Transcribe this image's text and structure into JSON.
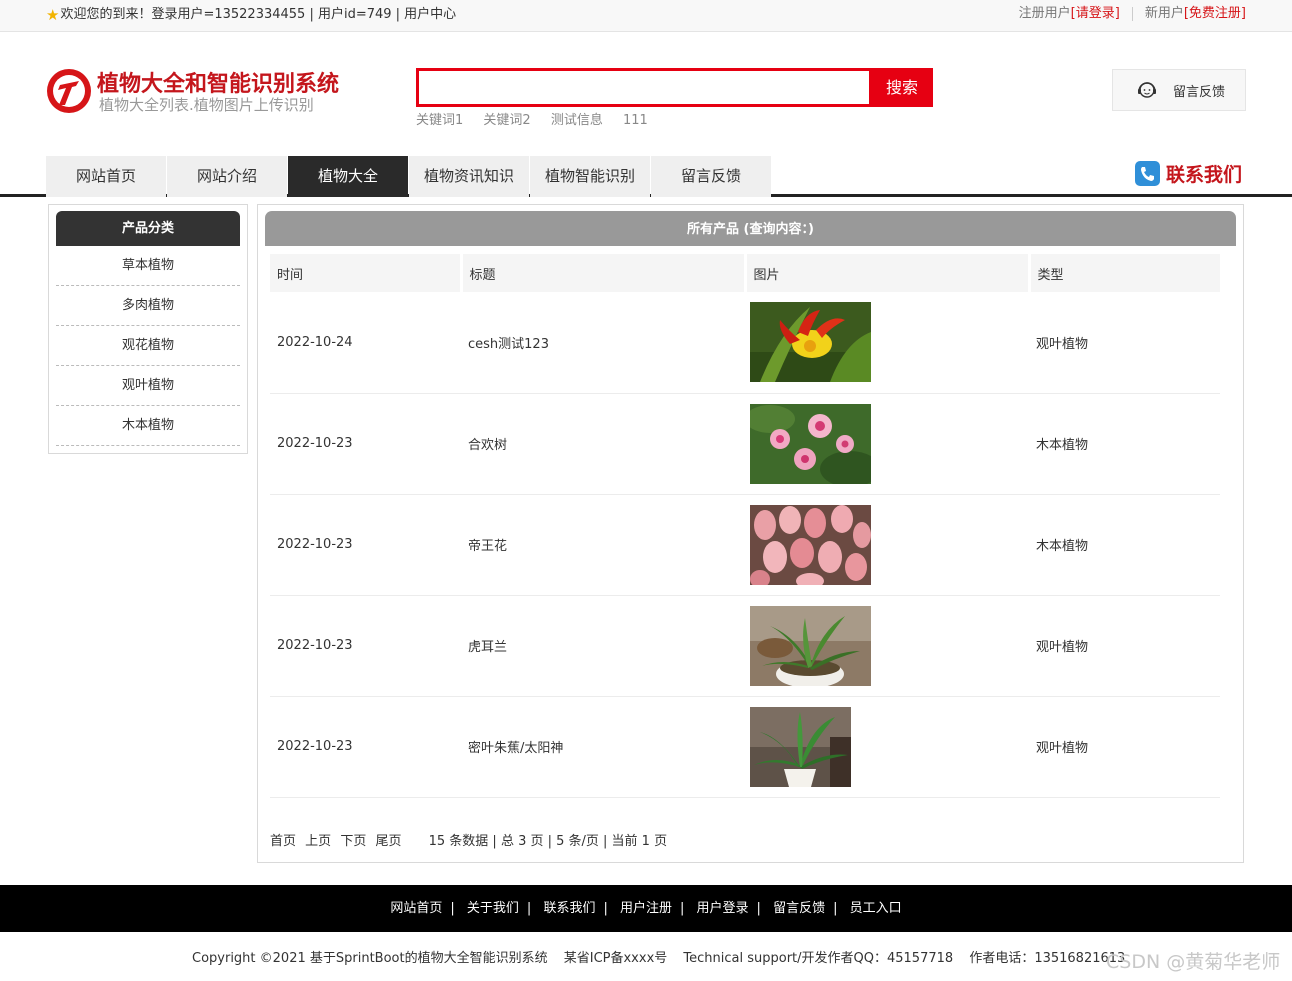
{
  "topbar": {
    "welcome": "欢迎您的到来！登录用户=13522334455 | 用户id=749 | 用户中心",
    "register_label": "注册用户",
    "login_link": "[请登录]",
    "newuser_label": "新用户",
    "signup_link": "[免费注册]"
  },
  "header": {
    "title": "植物大全和智能识别系统",
    "subtitle": "植物大全列表.植物图片上传识别",
    "search_button": "搜索",
    "search_placeholder": "",
    "keywords": [
      "关键词1",
      "关键词2",
      "测试信息",
      "111"
    ],
    "feedback": "留言反馈"
  },
  "nav": {
    "items": [
      "网站首页",
      "网站介绍",
      "植物大全",
      "植物资讯知识",
      "植物智能识别",
      "留言反馈"
    ],
    "active": "植物大全",
    "contact": "联系我们"
  },
  "sidebar": {
    "title": "产品分类",
    "items": [
      "草本植物",
      "多肉植物",
      "观花植物",
      "观叶植物",
      "木本植物"
    ]
  },
  "main": {
    "title": "所有产品 (查询内容：)",
    "columns": [
      "时间",
      "标题",
      "图片",
      "类型"
    ],
    "rows": [
      {
        "date": "2022-10-24",
        "title": "cesh测试123",
        "type": "观叶植物"
      },
      {
        "date": "2022-10-23",
        "title": "合欢树",
        "type": "木本植物"
      },
      {
        "date": "2022-10-23",
        "title": "帝王花",
        "type": "木本植物"
      },
      {
        "date": "2022-10-23",
        "title": "虎耳兰",
        "type": "观叶植物"
      },
      {
        "date": "2022-10-23",
        "title": "密叶朱蕉/太阳神",
        "type": "观叶植物"
      }
    ],
    "pager": {
      "first": "首页",
      "prev": "上页",
      "next": "下页",
      "last": "尾页",
      "info": "15 条数据 | 总 3 页 | 5 条/页 | 当前 1 页"
    }
  },
  "footer": {
    "links": [
      "网站首页",
      "关于我们",
      "联系我们",
      "用户注册",
      "用户登录",
      "留言反馈",
      "员工入口"
    ],
    "copyright": "Copyright ©2021 基于SprintBoot的植物大全智能识别系统",
    "icp": "某省ICP备xxxx号",
    "support": "Technical support/开发作者QQ：45157718",
    "phone": "作者电话：13516821613",
    "watermark": "CSDN @黄菊华老师"
  },
  "colors": {
    "accent_red": "#e60012",
    "title_red": "#c4161c",
    "nav_active": "#2a2a2a",
    "footer_bg": "#000000"
  }
}
